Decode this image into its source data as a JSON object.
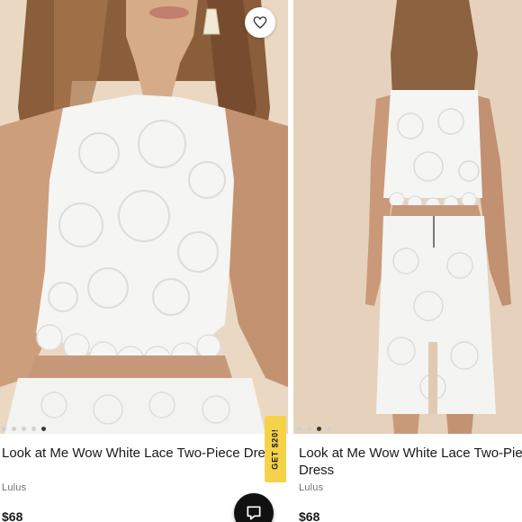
{
  "listings": [
    {
      "title": "Look at Me Wow White Lace Two-Piece Dress",
      "brand": "Lulus",
      "price": "$68",
      "carousel_dots": 5,
      "active_dot": 4,
      "photo_icon": "lace-top-front-photo"
    },
    {
      "title": "Look at Me Wow White Lace Two-Piece Dress",
      "brand": "Lulus",
      "price": "$68",
      "carousel_dots": 4,
      "active_dot": 2,
      "photo_icon": "lace-dress-back-photo"
    }
  ],
  "promo": {
    "label": "GET $20!",
    "color": "#f6d24a"
  },
  "actions": {
    "like_icon": "heart-icon",
    "chat_icon": "chat-bubble-icon"
  },
  "colors": {
    "lace": "#f4f4f2",
    "skin": "#c79a78",
    "hair": "#7a5234",
    "backdrop": "#e9d9c6"
  }
}
